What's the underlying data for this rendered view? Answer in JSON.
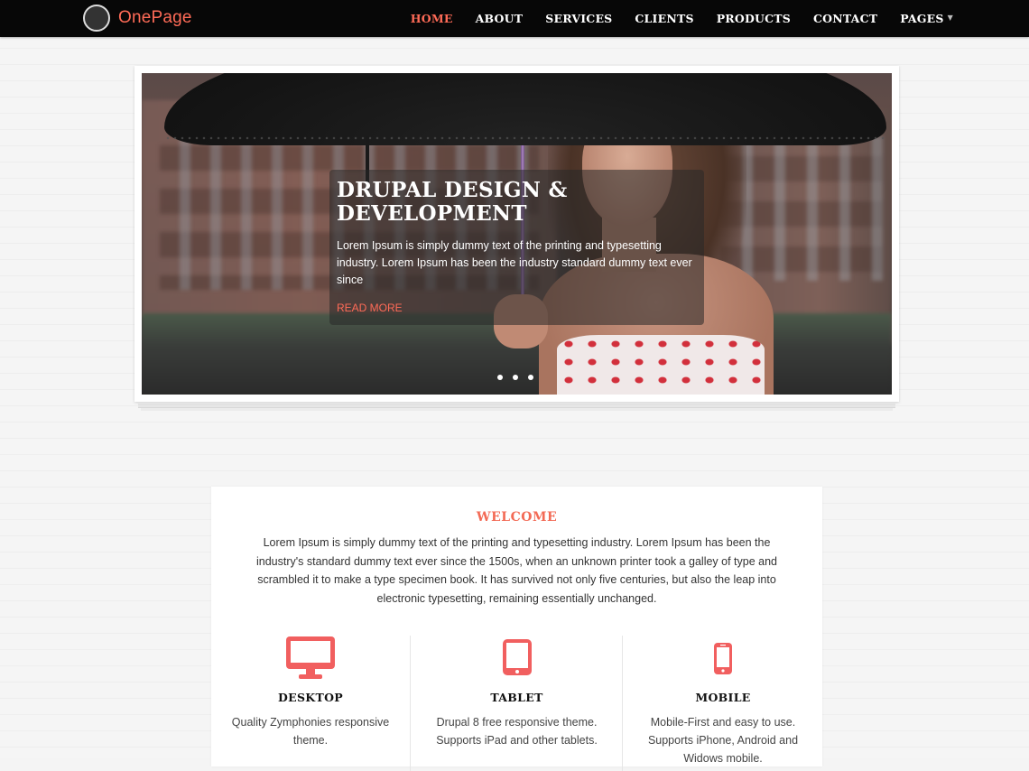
{
  "brand": {
    "name": "OnePage",
    "accent_color": "#ff6b57"
  },
  "nav": {
    "items": [
      {
        "label": "HOME",
        "active": true
      },
      {
        "label": "ABOUT"
      },
      {
        "label": "SERVICES"
      },
      {
        "label": "CLIENTS"
      },
      {
        "label": "PRODUCTS"
      },
      {
        "label": "CONTACT"
      },
      {
        "label": "PAGES",
        "dropdown": true
      }
    ]
  },
  "slider": {
    "caption": {
      "title": "DRUPAL DESIGN & DEVELOPMENT",
      "text": "Lorem Ipsum is simply dummy text of the printing and typesetting industry. Lorem Ipsum has been the industry standard dummy text ever since",
      "link": "READ MORE"
    },
    "slide_count": 3,
    "active_slide": 1
  },
  "welcome": {
    "title": "WELCOME",
    "text": "Lorem Ipsum is simply dummy text of the printing and typesetting industry. Lorem Ipsum has been the industry's standard dummy text ever since the 1500s, when an unknown printer took a galley of type and scrambled it to make a type specimen book. It has survived not only five centuries, but also the leap into electronic typesetting, remaining essentially unchanged."
  },
  "features": [
    {
      "icon": "desktop-icon",
      "title": "DESKTOP",
      "text": "Quality Zymphonies responsive theme."
    },
    {
      "icon": "tablet-icon",
      "title": "TABLET",
      "text": "Drupal 8 free responsive theme. Supports iPad and other tablets."
    },
    {
      "icon": "mobile-icon",
      "title": "MOBILE",
      "text": "Mobile-First and easy to use. Supports iPhone, Android and Widows mobile."
    }
  ]
}
